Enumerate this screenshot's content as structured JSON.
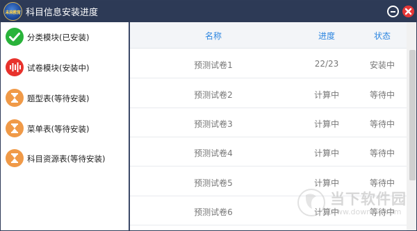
{
  "window": {
    "title": "科目信息安装进度",
    "logo_text": "未来教育"
  },
  "sidebar": {
    "steps": [
      {
        "label": "分类模块(已安装)",
        "status": "done",
        "icon": "check-icon"
      },
      {
        "label": "试卷模块(安装中)",
        "status": "installing",
        "icon": "audio-wave-icon"
      },
      {
        "label": "题型表(等待安装)",
        "status": "waiting",
        "icon": "hourglass-icon"
      },
      {
        "label": "菜单表(等待安装)",
        "status": "waiting",
        "icon": "hourglass-icon"
      },
      {
        "label": "科目资源表(等待安装)",
        "status": "waiting",
        "icon": "hourglass-icon"
      }
    ]
  },
  "table": {
    "headers": {
      "name": "名称",
      "progress": "进度",
      "state": "状态"
    },
    "rows": [
      {
        "name": "预测试卷1",
        "progress": "22/23",
        "state": "安装中"
      },
      {
        "name": "预测试卷2",
        "progress": "计算中",
        "state": "等待中"
      },
      {
        "name": "预测试卷3",
        "progress": "计算中",
        "state": "等待中"
      },
      {
        "name": "预测试卷4",
        "progress": "计算中",
        "state": "等待中"
      },
      {
        "name": "预测试卷5",
        "progress": "计算中",
        "state": "等待中"
      },
      {
        "name": "预测试卷6",
        "progress": "计算中",
        "state": "等待中"
      }
    ]
  },
  "watermark": {
    "text": "当下软件园",
    "url": "www.downxia.com"
  },
  "colors": {
    "titlebar": "#2d3a56",
    "header_text": "#2d86e0",
    "done": "#29b33a",
    "installing": "#e8322c",
    "waiting": "#f09a48",
    "close": "#e63737"
  }
}
